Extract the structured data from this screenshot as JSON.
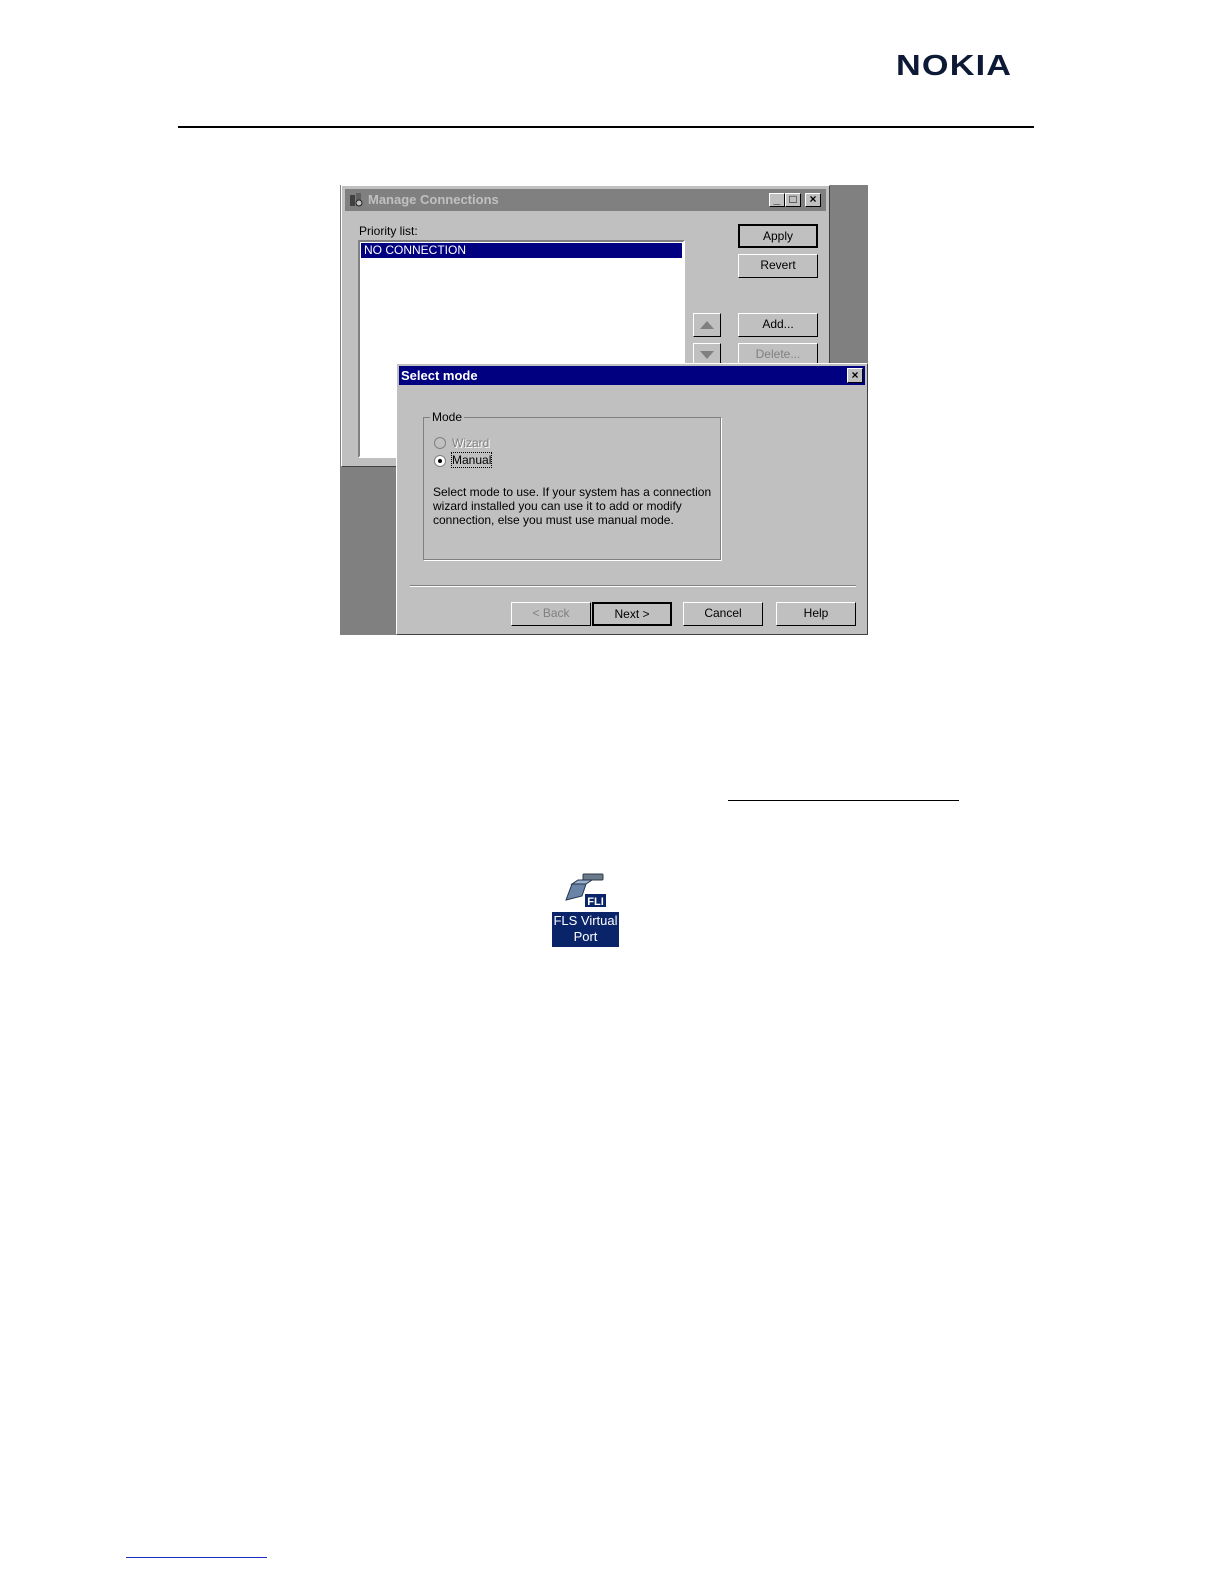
{
  "header": {
    "logo": "NOKIA"
  },
  "manage_connections": {
    "title": "Manage Connections",
    "priority_label": "Priority list:",
    "list_items": [
      "NO CONNECTION"
    ],
    "buttons": {
      "apply": "Apply",
      "revert": "Revert",
      "add": "Add...",
      "delete": "Delete..."
    }
  },
  "select_mode": {
    "title": "Select mode",
    "group_label": "Mode",
    "options": [
      {
        "label": "Wizard",
        "enabled": false,
        "selected": false
      },
      {
        "label": "Manual",
        "enabled": true,
        "selected": true
      }
    ],
    "description": "Select mode to use. If your system has a connection wizard installed you can use it to add or modify connection, else you must use manual mode.",
    "buttons": {
      "back": "< Back",
      "next": "Next >",
      "cancel": "Cancel",
      "help": "Help"
    }
  },
  "desktop_icon": {
    "label": "FLS Virtual Port",
    "badge": "FLI"
  },
  "colors": {
    "selection": "#000080",
    "dialog_face": "#c0c0c0",
    "icon_label_bg": "#0a246a"
  }
}
